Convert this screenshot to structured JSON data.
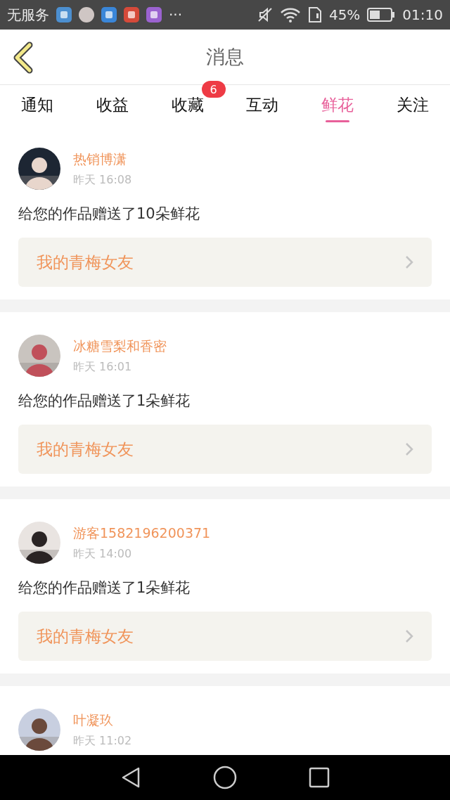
{
  "status_bar": {
    "carrier": "无服务",
    "more": "···",
    "battery_text": "45%",
    "time": "01:10"
  },
  "header": {
    "title": "消息"
  },
  "tabs": [
    {
      "label": "通知",
      "selected": false
    },
    {
      "label": "收益",
      "selected": false
    },
    {
      "label": "收藏",
      "selected": false,
      "badge": "6"
    },
    {
      "label": "互动",
      "selected": false
    },
    {
      "label": "鲜花",
      "selected": true
    },
    {
      "label": "关注",
      "selected": false
    }
  ],
  "messages": [
    {
      "user": "热销博潇",
      "time": "昨天 16:08",
      "text": "给您的作品赠送了10朵鲜花",
      "work": "我的青梅女友"
    },
    {
      "user": "冰糖雪梨和香密",
      "time": "昨天 16:01",
      "text": "给您的作品赠送了1朵鲜花",
      "work": "我的青梅女友"
    },
    {
      "user": "游客1582196200371",
      "time": "昨天 14:00",
      "text": "给您的作品赠送了1朵鲜花",
      "work": "我的青梅女友"
    },
    {
      "user": "叶凝玖",
      "time": "昨天 11:02"
    }
  ]
}
